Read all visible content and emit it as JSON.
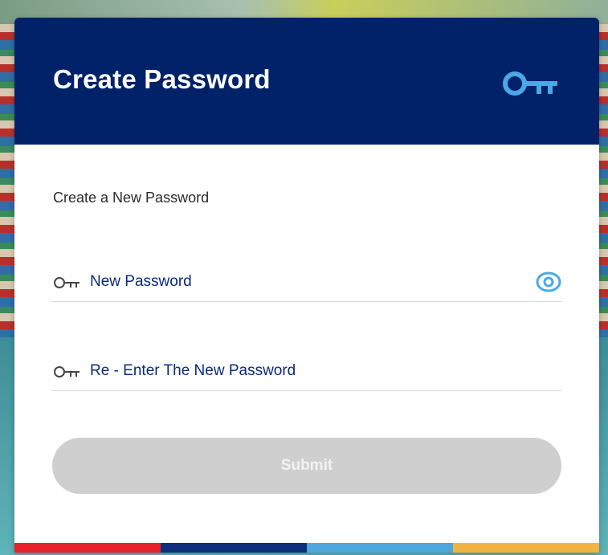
{
  "header": {
    "title": "Create Password",
    "icon": "key-icon"
  },
  "form": {
    "subtitle": "Create a New Password",
    "new_password": {
      "placeholder": "New Password",
      "value": "",
      "icon": "key-icon",
      "toggle_icon": "eye-icon"
    },
    "confirm_password": {
      "placeholder": "Re - Enter The New Password",
      "value": "",
      "icon": "key-icon"
    },
    "submit_label": "Submit"
  },
  "colors": {
    "header_bg": "#012169",
    "accent_blue": "#4aa8e6",
    "submit_disabled": "#cfcfcf",
    "stripe": [
      "#e8202a",
      "#0b2f7a",
      "#4ea7dd",
      "#f2b441"
    ]
  }
}
